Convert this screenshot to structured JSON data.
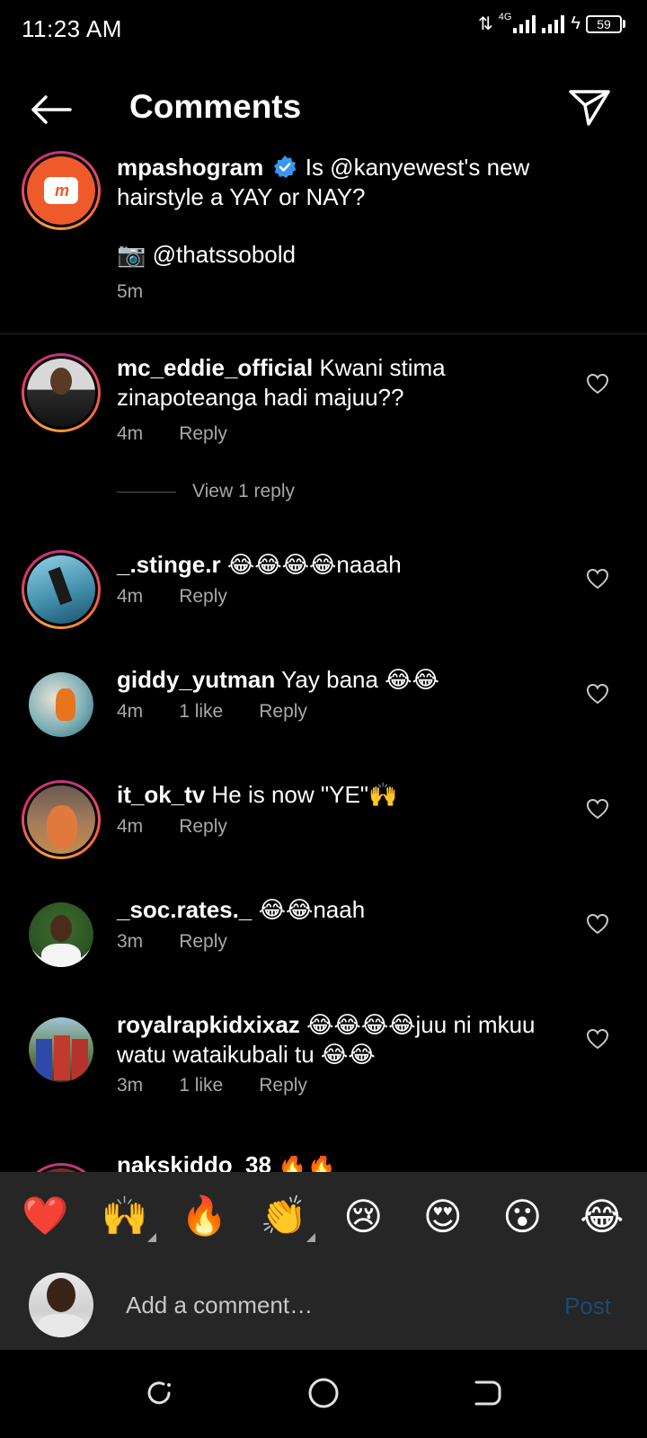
{
  "status_bar": {
    "time": "11:23 AM",
    "network": "4G",
    "battery": "59"
  },
  "header": {
    "title": "Comments"
  },
  "caption": {
    "username": "mpashogram",
    "logo_text": "m",
    "text": "Is @kanyewest's new hairstyle a YAY or NAY?",
    "credit": "📷 @thatssobold",
    "time": "5m"
  },
  "comments": [
    {
      "username": "mc_eddie_official",
      "text": "Kwani stima zinapoteanga hadi majuu??",
      "time": "4m",
      "likes": "",
      "reply": "Reply"
    },
    {
      "username": "_.stinge.r",
      "text": "😂😂😂😂naaah",
      "time": "4m",
      "likes": "",
      "reply": "Reply"
    },
    {
      "username": "giddy_yutman",
      "text": "Yay bana 😂😂",
      "time": "4m",
      "likes": "1 like",
      "reply": "Reply"
    },
    {
      "username": "it_ok_tv",
      "text": "He is now \"YE\"🙌",
      "time": "4m",
      "likes": "",
      "reply": "Reply"
    },
    {
      "username": "_soc.rates._",
      "text": "😂😂naah",
      "time": "3m",
      "likes": "",
      "reply": "Reply"
    },
    {
      "username": "royalrapkidxixaz",
      "text": "😂😂😂😂juu ni mkuu watu wataikubali tu 😂😂",
      "time": "3m",
      "likes": "1 like",
      "reply": "Reply"
    },
    {
      "username": "nakskiddo_38",
      "text": "🔥🔥",
      "time": "",
      "likes": "",
      "reply": ""
    }
  ],
  "view_replies": "View 1 reply",
  "reactions": [
    "❤️",
    "🙌",
    "🔥",
    "👏",
    "😢",
    "😍",
    "😮",
    "😂"
  ],
  "composer": {
    "placeholder": "Add a comment…",
    "post_label": "Post"
  },
  "icons": [
    "back-arrow-icon",
    "send-icon",
    "verified-badge-icon",
    "heart-icon",
    "nav-recents-icon",
    "nav-home-icon",
    "nav-back-icon"
  ],
  "colors": {
    "background": "#000000",
    "secondary_text": "#a8a8a8",
    "post_disabled": "#1b4a73",
    "verified": "#3897f0",
    "brand": "#ef5a2b",
    "bar": "#262626"
  }
}
